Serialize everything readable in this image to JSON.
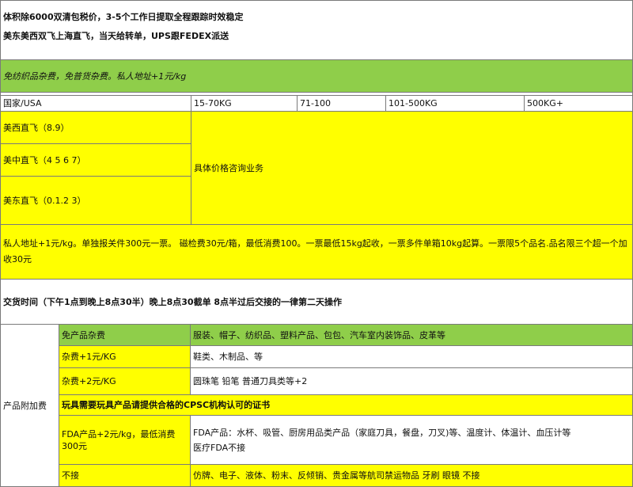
{
  "header": {
    "line1": "体积除6000双清包税价，3-5个工作日提取全程跟踪时效稳定",
    "line2": "美东美西双飞上海直飞，当天给转单，UPS跟FEDEX派送"
  },
  "green_note": "免纺织品杂费，免普货杂费。私人地址+1元/kg",
  "rate_table": {
    "headers": [
      "国家/USA",
      "15-70KG",
      "71-100",
      "101-500KG",
      "500KG+"
    ],
    "routes": [
      "美西直飞（8.9）",
      "美中直飞（4 5 6 7）",
      "美东直飞（0.1.2 3）"
    ],
    "price_note": "具体价格咨询业务"
  },
  "yellow_note": "私人地址+1元/kg。单独报关件300元一票。   磁检费30元/箱，最低消费100。一票最低15kg起收，一票多件单箱10kg起算。一票限5个品名.品名限三个超一个加收30元",
  "delivery_time": "交货时间（下午1点到晚上8点30半）晚上8点30截单 8点半过后交接的一律第二天操作",
  "surcharge": {
    "label": "产品附加费",
    "rows": [
      {
        "left": "免产品杂费",
        "right": "服装、帽子、纺织品、塑料产品、包包、汽车室内装饰品、皮革等"
      },
      {
        "left": "杂费+1元/KG",
        "right": "鞋类、木制品、等"
      },
      {
        "left": "杂费+2元/KG",
        "right": "圆珠笔 铅笔 普通刀具类等+2"
      },
      {
        "left": "FDA产品+2元/kg，最低消费300元",
        "right_lines": [
          "FDA产品：水杯、吸管、厨房用品类产品（家庭刀具，餐盘，刀叉)等、温度计、体温计、血压计等",
          "医疗FDA不接"
        ]
      },
      {
        "left": "不接",
        "right": "仿牌、电子、液体、粉末、反倾销、贵金属等航司禁运物品 牙刷 眼镜 不接"
      }
    ],
    "cpsc_note": "玩具需要玩具产品请提供合格的CPSC机构认可的证书"
  }
}
